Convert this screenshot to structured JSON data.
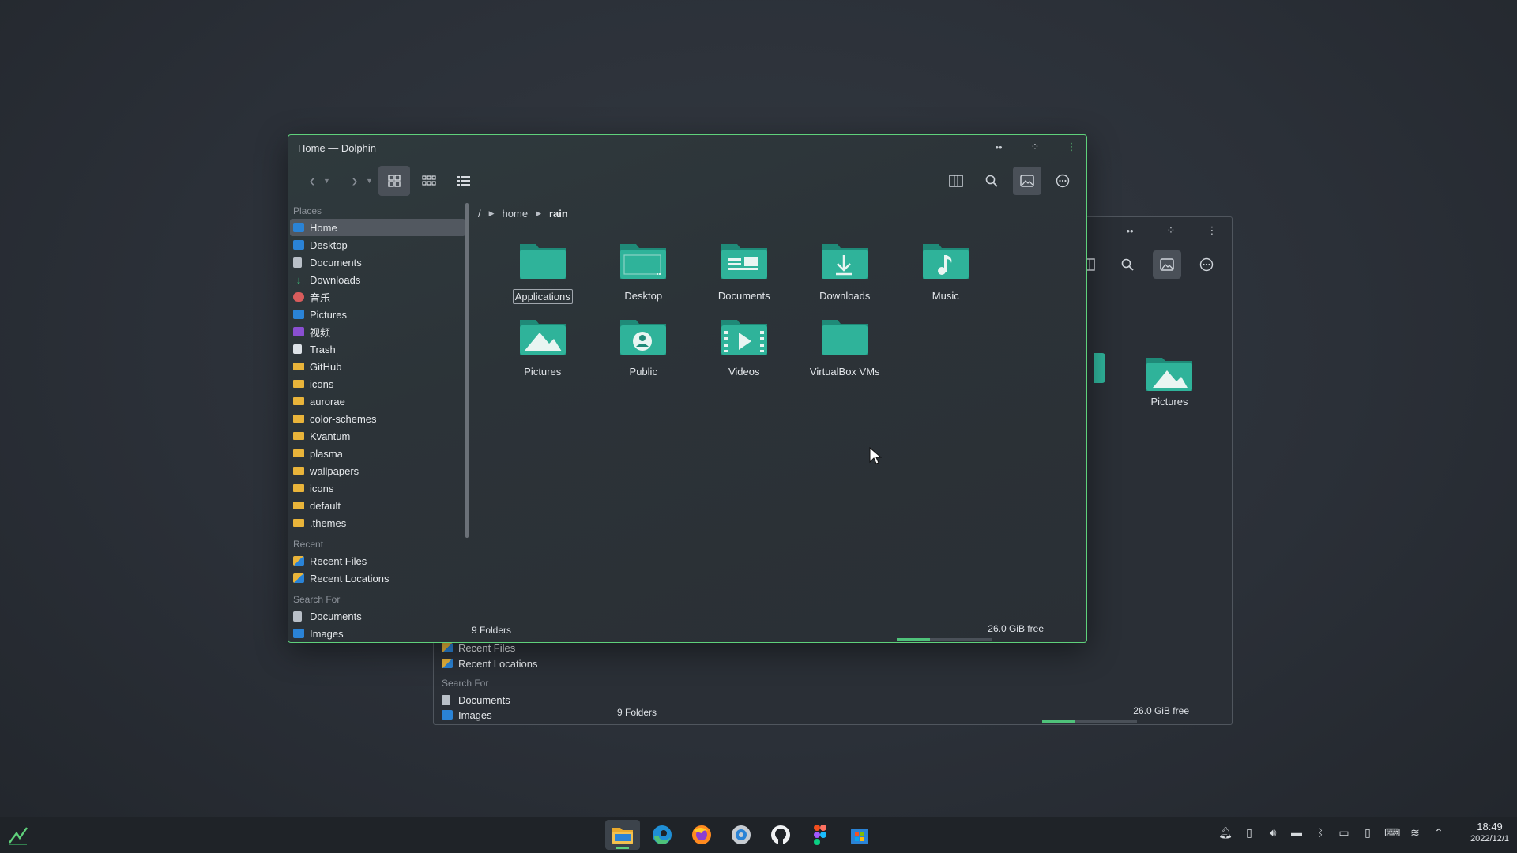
{
  "window": {
    "title": "Home — Dolphin"
  },
  "breadcrumb": [
    "/",
    "home",
    "rain"
  ],
  "sidebar": {
    "places_title": "Places",
    "places": [
      {
        "label": "Home",
        "icon": "home-icon"
      },
      {
        "label": "Desktop",
        "icon": "desktop-icon"
      },
      {
        "label": "Documents",
        "icon": "document-icon"
      },
      {
        "label": "Downloads",
        "icon": "download-icon"
      },
      {
        "label": "音乐",
        "icon": "music-icon"
      },
      {
        "label": "Pictures",
        "icon": "pictures-icon"
      },
      {
        "label": "视频",
        "icon": "video-icon"
      },
      {
        "label": "Trash",
        "icon": "trash-icon"
      },
      {
        "label": "GitHub",
        "icon": "folder-icon"
      },
      {
        "label": "icons",
        "icon": "folder-icon"
      },
      {
        "label": "aurorae",
        "icon": "folder-icon"
      },
      {
        "label": "color-schemes",
        "icon": "folder-icon"
      },
      {
        "label": "Kvantum",
        "icon": "folder-icon"
      },
      {
        "label": "plasma",
        "icon": "folder-icon"
      },
      {
        "label": "wallpapers",
        "icon": "folder-icon"
      },
      {
        "label": "icons",
        "icon": "folder-icon"
      },
      {
        "label": "default",
        "icon": "folder-icon"
      },
      {
        "label": ".themes",
        "icon": "folder-icon"
      }
    ],
    "recent_title": "Recent",
    "recent": [
      {
        "label": "Recent Files",
        "icon": "recent-files-icon"
      },
      {
        "label": "Recent Locations",
        "icon": "recent-locations-icon"
      }
    ],
    "search_title": "Search For",
    "search": [
      {
        "label": "Documents",
        "icon": "document-icon"
      },
      {
        "label": "Images",
        "icon": "image-icon"
      }
    ]
  },
  "folders": [
    {
      "label": "Applications",
      "icon": "applications-folder-icon"
    },
    {
      "label": "Desktop",
      "icon": "desktop-folder-icon"
    },
    {
      "label": "Documents",
      "icon": "documents-folder-icon"
    },
    {
      "label": "Downloads",
      "icon": "downloads-folder-icon"
    },
    {
      "label": "Music",
      "icon": "music-folder-icon"
    },
    {
      "label": "Pictures",
      "icon": "pictures-folder-icon"
    },
    {
      "label": "Public",
      "icon": "public-folder-icon"
    },
    {
      "label": "Videos",
      "icon": "videos-folder-icon"
    },
    {
      "label": "VirtualBox VMs",
      "icon": "folder-icon"
    }
  ],
  "status": {
    "folder_count": "9 Folders",
    "free_space": "26.0 GiB free",
    "used_fraction": 0.35
  },
  "bg_window": {
    "folder_label": "Pictures",
    "recent_files": "Recent Files",
    "recent_locations": "Recent Locations",
    "search_title": "Search For",
    "search_documents": "Documents",
    "search_images": "Images",
    "folder_count": "9 Folders",
    "free_space": "26.0 GiB free"
  },
  "taskbar": {
    "apps": [
      "dolphin-icon",
      "edge-icon",
      "firefox-icon",
      "settings-icon",
      "github-icon",
      "figma-icon",
      "store-icon"
    ],
    "time": "18:49",
    "date": "2022/12/1"
  },
  "colors": {
    "accent": "#5fd17b",
    "folder_teal": "#2fb39a",
    "folder_teal_dark": "#1f8a78"
  }
}
